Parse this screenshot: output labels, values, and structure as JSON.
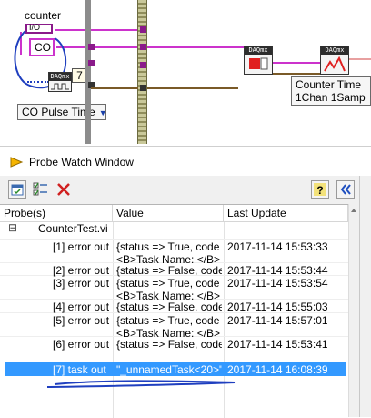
{
  "diagram": {
    "counter_label": "counter",
    "io_icon_text": "I/O",
    "co_text": "CO",
    "constant_value": "7",
    "co_pulse_time_ring": "CO Pulse Time",
    "counter_time_ring_line1": "Counter Time",
    "counter_time_ring_line2": "1Chan 1Samp",
    "daqmx_header": "DAQmx"
  },
  "window": {
    "title": "Probe Watch Window"
  },
  "toolbar": {
    "buttons": [
      "select-all-icon",
      "checkbox-list-icon",
      "delete-icon",
      "help-icon",
      "collapse-icon"
    ]
  },
  "grid": {
    "columns": [
      "Probe(s)",
      "Value",
      "Last Update"
    ],
    "root": "CounterTest.vi",
    "collapse_glyph": "⊟",
    "rows": [
      {
        "probe": "[1] error out",
        "value1": "{status => True, code",
        "value2": "<B>Task Name: </B>",
        "time": "2017-11-14 15:53:33"
      },
      {
        "probe": "[2] error out",
        "value1": "{status => False, code",
        "value2": "",
        "time": "2017-11-14 15:53:44"
      },
      {
        "probe": "[3] error out",
        "value1": "{status => True, code",
        "value2": "<B>Task Name: </B>",
        "time": "2017-11-14 15:53:54"
      },
      {
        "probe": "[4] error out",
        "value1": "{status => False, code",
        "value2": "",
        "time": "2017-11-14 15:55:03"
      },
      {
        "probe": "[5] error out",
        "value1": "{status => True, code",
        "value2": "<B>Task Name: </B>",
        "time": "2017-11-14 15:57:01"
      },
      {
        "probe": "[6] error out",
        "value1": "{status => False, code",
        "value2": "",
        "time": "2017-11-14 15:53:41"
      },
      {
        "probe": "[7] task out",
        "value1": "\"_unnamedTask<20>\"",
        "value2": "",
        "time": "2017-11-14 16:08:39"
      }
    ]
  },
  "colors": {
    "selection": "#3399ff",
    "wire_pink": "#cc33cc",
    "annotation_blue": "#1f3fbf"
  }
}
